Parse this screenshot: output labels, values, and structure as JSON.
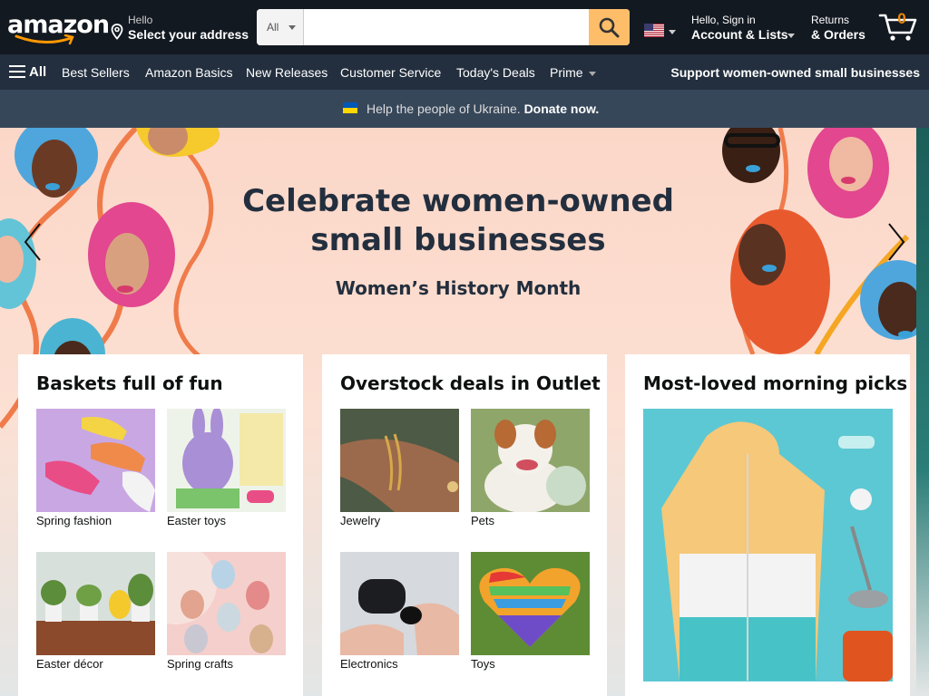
{
  "header": {
    "logo_text": "amazon",
    "address_line1": "Hello",
    "address_line2": "Select your address",
    "search": {
      "category": "All",
      "placeholder": "",
      "value": ""
    },
    "account_line1": "Hello, Sign in",
    "account_line2": "Account & Lists",
    "orders_line1": "Returns",
    "orders_line2": "& Orders",
    "cart_count": "0"
  },
  "subnav": {
    "all_label": "All",
    "links": [
      "Best Sellers",
      "Amazon Basics",
      "New Releases",
      "Customer Service",
      "Today's Deals",
      "Prime"
    ],
    "promo": "Support women-owned small businesses"
  },
  "banner": {
    "text": "Help the people of Ukraine.",
    "link": "Donate now."
  },
  "hero": {
    "title_line1": "Celebrate women-owned",
    "title_line2": "small businesses",
    "subtitle": "Women’s History Month"
  },
  "cards": [
    {
      "title": "Baskets full of fun",
      "tiles": [
        "Spring fashion",
        "Easter toys",
        "Easter décor",
        "Spring crafts"
      ]
    },
    {
      "title": "Overstock deals in Outlet",
      "tiles": [
        "Jewelry",
        "Pets",
        "Electronics",
        "Toys"
      ]
    },
    {
      "title": "Most-loved morning picks"
    }
  ],
  "colors": {
    "nav_dark": "#131921",
    "nav_sub": "#232f3e",
    "banner": "#37475a",
    "search_button": "#febd69",
    "cart_count": "#f08804",
    "hero_bg": "#fbd7c8"
  }
}
